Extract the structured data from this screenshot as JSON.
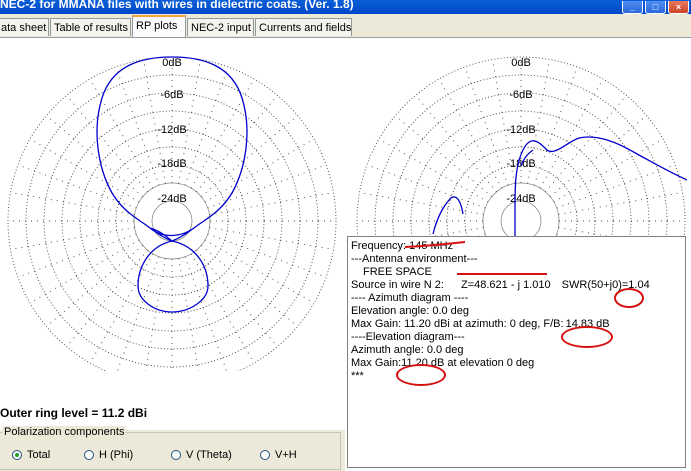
{
  "window": {
    "title": "NEC-2 for MMANA files with wires in dielectric coats. (Ver. 1.8)",
    "buttons": {
      "minimize": "_",
      "maximize": "□",
      "close": "×"
    }
  },
  "tabs": [
    {
      "label": "ata sheet",
      "active": false
    },
    {
      "label": "Table of results",
      "active": false
    },
    {
      "label": "RP plots",
      "active": true
    },
    {
      "label": "NEC-2 input",
      "active": false
    },
    {
      "label": "Currents and fields",
      "active": false
    }
  ],
  "plot": {
    "ring_labels": [
      "0dB",
      "-6dB",
      "-12dB",
      "-18dB",
      "-24dB"
    ],
    "pattern_color": "#0000cc",
    "outer_ring_level": "Outer ring level = 11.2 dBi"
  },
  "info": {
    "frequency": "Frequency:  145  MHz",
    "env_header": "---Antenna environment---",
    "env_value": "FREE SPACE",
    "source_prefix": "Source in wire N 2:",
    "impedance": "Z=48.621 - j 1.010",
    "swr_label": "SWR(50+j0)=",
    "swr_value": "1.04",
    "az_header": "---- Azimuth diagram ----",
    "elev_angle": "Elevation angle: 0.0 deg",
    "az_gain_prefix": "Max Gain: 11.20 dBi  at azimuth: 0 deg,  F/B:",
    "fb_value": "14.83 dB",
    "el_header": "----Elevation diagram---",
    "az_angle": "Azimuth angle: 0.0 deg",
    "el_gain_prefix": "Max Gain:",
    "el_gain_value": "11.20 dB",
    "el_gain_suffix": " at elevation  0 deg",
    "end": "***"
  },
  "polarization": {
    "legend": "Polarization components",
    "options": [
      {
        "label": "Total",
        "selected": true
      },
      {
        "label": "H (Phi)",
        "selected": false
      },
      {
        "label": "V (Theta)",
        "selected": false
      },
      {
        "label": "V+H",
        "selected": false
      }
    ]
  }
}
